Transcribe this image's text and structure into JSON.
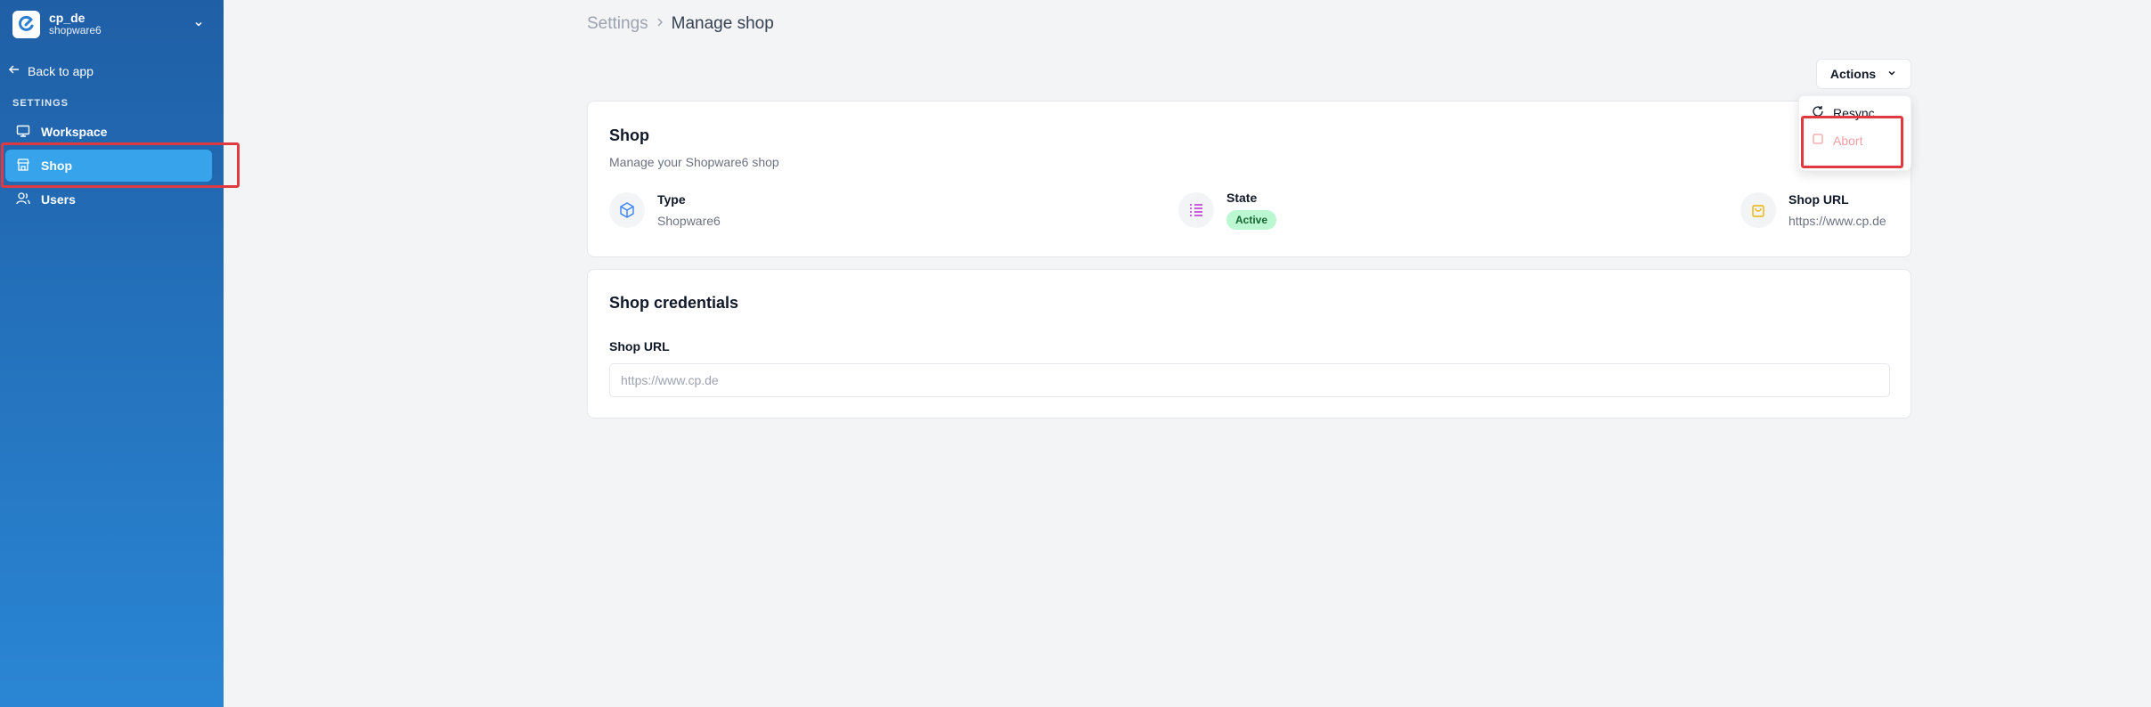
{
  "sidebar": {
    "workspace_name": "cp_de",
    "workspace_sub": "shopware6",
    "back_label": "Back to app",
    "section_label": "SETTINGS",
    "items": [
      {
        "label": "Workspace"
      },
      {
        "label": "Shop"
      },
      {
        "label": "Users"
      }
    ]
  },
  "breadcrumb": {
    "settings": "Settings",
    "current": "Manage shop"
  },
  "actions": {
    "label": "Actions",
    "menu": {
      "resync": "Resync",
      "abort": "Abort"
    }
  },
  "shop_card": {
    "title": "Shop",
    "description": "Manage your Shopware6 shop",
    "type_label": "Type",
    "type_value": "Shopware6",
    "state_label": "State",
    "state_value": "Active",
    "url_label": "Shop URL",
    "url_value": "https://www.cp.de"
  },
  "credentials_card": {
    "title": "Shop credentials",
    "field_label": "Shop URL",
    "field_placeholder": "https://www.cp.de"
  },
  "colors": {
    "accent": "#36a3ea",
    "highlight": "#e03a40",
    "badge_bg": "#bbf7d0",
    "abort": "#f4a0a4"
  }
}
